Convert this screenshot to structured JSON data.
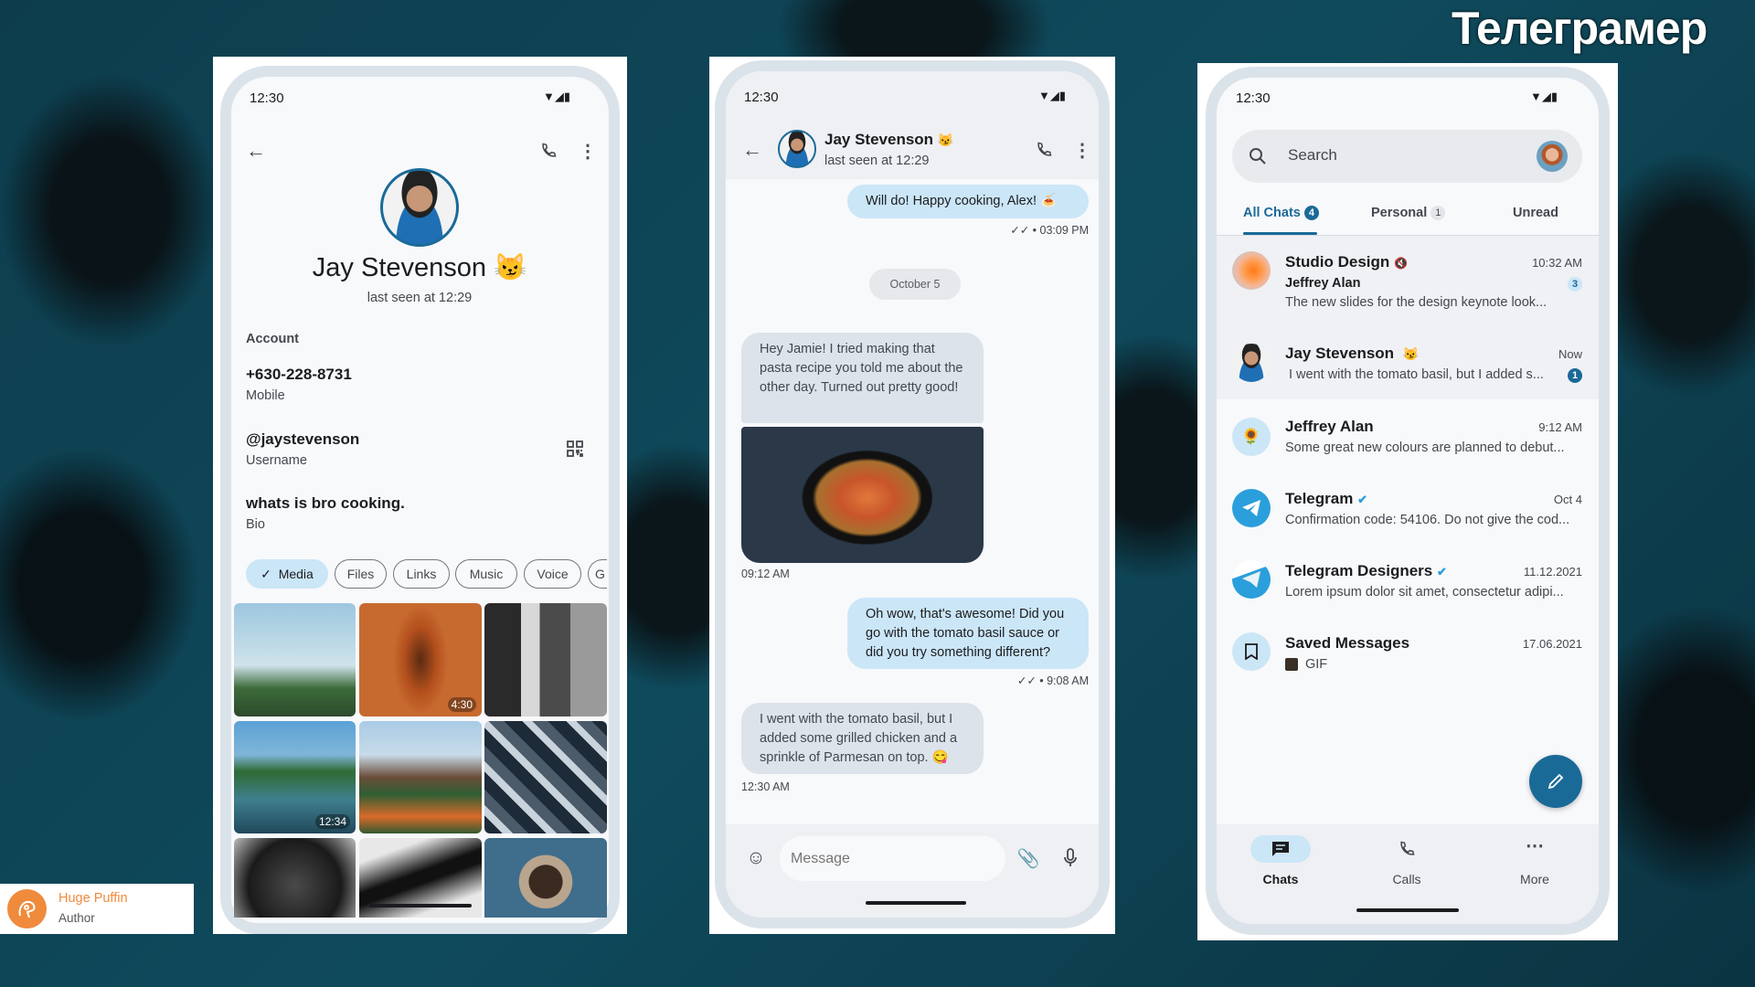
{
  "watermark": "Телеграмер",
  "author": {
    "name": "Huge Puffin",
    "role": "Author",
    "accent": "#f08a3c"
  },
  "status": {
    "time": "12:30"
  },
  "profile": {
    "name": "Jay Stevenson",
    "name_emoji": "😼",
    "last_seen": "last seen at 12:29",
    "section": "Account",
    "phone": "+630-228-8731",
    "phone_label": "Mobile",
    "username": "@jaystevenson",
    "username_label": "Username",
    "bio": "whats is bro cooking.",
    "bio_label": "Bio",
    "chips": [
      "Media",
      "Files",
      "Links",
      "Music",
      "Voice",
      "G"
    ],
    "selected_chip": "Media",
    "media_durations": [
      "4:30",
      "12:34"
    ]
  },
  "chat": {
    "name": "Jay Stevenson",
    "name_emoji": "😼",
    "last_seen": "last seen at 12:29",
    "messages": [
      {
        "dir": "out",
        "text": "Will do! Happy cooking, Alex! 🍝",
        "time": "✓✓ • 03:09 PM"
      },
      {
        "dir": "date",
        "text": "October 5"
      },
      {
        "dir": "in",
        "text": "Hey Jamie! I tried making that pasta recipe you told me about the other day. Turned out pretty good!",
        "time": "09:12 AM",
        "has_image": true
      },
      {
        "dir": "out",
        "text": "Oh wow, that's awesome! Did you go with the tomato basil sauce or did you try something different?",
        "time": "✓✓ • 9:08 AM"
      },
      {
        "dir": "in",
        "text": "I went with the tomato basil, but I added some grilled chicken and a sprinkle of Parmesan on top. 😋",
        "time": "12:30 AM"
      }
    ],
    "input_placeholder": "Message"
  },
  "chats": {
    "search_placeholder": "Search",
    "tabs": [
      {
        "label": "All Chats",
        "count": "4",
        "active": true
      },
      {
        "label": "Personal",
        "count": "1"
      },
      {
        "label": "Unread"
      }
    ],
    "rows": [
      {
        "name": "Studio Design",
        "muted": true,
        "time": "10:32 AM",
        "sender": "Jeffrey Alan",
        "preview": "The new slides for the design keynote look...",
        "unread": "3"
      },
      {
        "name": "Jay Stevenson",
        "emoji": "😼",
        "time": "Now",
        "preview": "I went with the tomato basil, but I added s...",
        "unread": "1"
      },
      {
        "name": "Jeffrey Alan",
        "time": "9:12 AM",
        "preview": "Some great new colours are planned to debut..."
      },
      {
        "name": "Telegram",
        "verified": true,
        "time": "Oct 4",
        "preview": "Confirmation code: 54106. Do not give the cod..."
      },
      {
        "name": "Telegram Designers",
        "verified": true,
        "time": "11.12.2021",
        "preview": "Lorem ipsum dolor sit amet, consectetur adipi..."
      },
      {
        "name": "Saved Messages",
        "time": "17.06.2021",
        "preview": "GIF"
      }
    ],
    "nav": [
      {
        "label": "Chats",
        "active": true
      },
      {
        "label": "Calls"
      },
      {
        "label": "More"
      }
    ],
    "accent": "#1a6a98"
  }
}
